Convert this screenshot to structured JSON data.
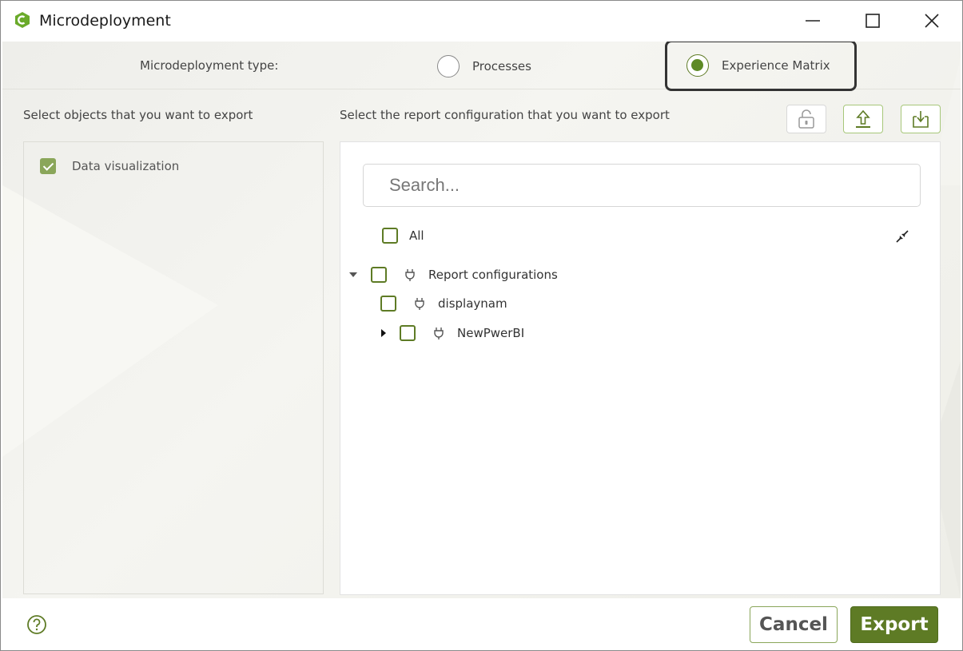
{
  "window": {
    "title": "Microdeployment",
    "brand_color": "#5e8a26"
  },
  "type_row": {
    "label": "Microdeployment type:",
    "options": [
      {
        "label": "Processes",
        "selected": false
      },
      {
        "label": "Experience Matrix",
        "selected": true
      }
    ]
  },
  "left_section": {
    "label": "Select objects that you want to export",
    "items": [
      {
        "label": "Data visualization",
        "checked": true
      }
    ]
  },
  "right_section": {
    "label": "Select the report configuration that you want to export",
    "toolbar": {
      "icons": [
        "unlock-icon",
        "upload-icon",
        "download-icon"
      ]
    },
    "search": {
      "placeholder": "Search...",
      "value": ""
    },
    "all_label": "All",
    "tree": [
      {
        "label": "Report configurations",
        "expanded": true,
        "checked": false
      },
      {
        "label": "displaynam",
        "checked": false
      },
      {
        "label": "NewPwerBI",
        "expanded": false,
        "checked": false
      }
    ]
  },
  "footer": {
    "cancel_label": "Cancel",
    "export_label": "Export"
  }
}
